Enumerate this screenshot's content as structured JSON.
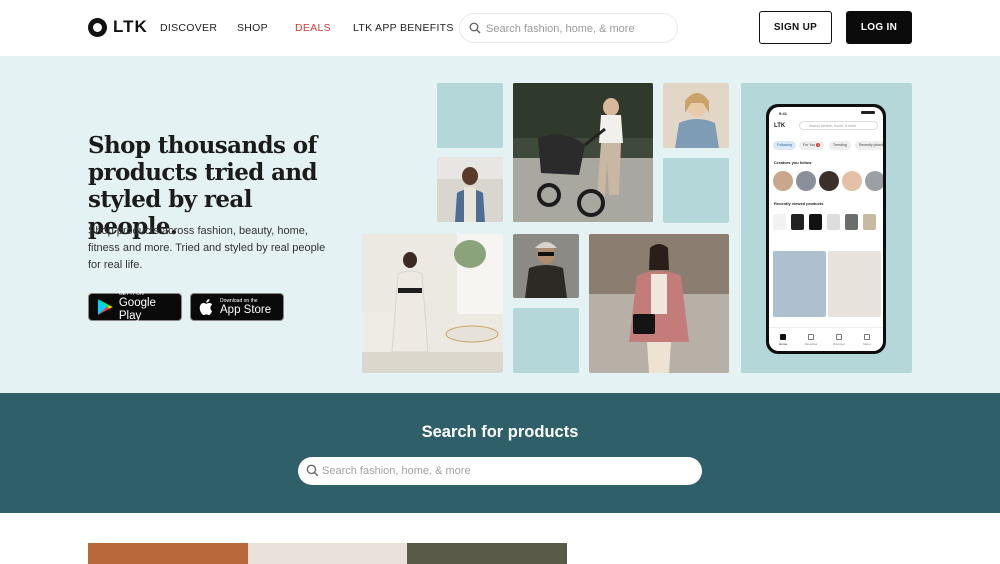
{
  "header": {
    "logo_text": "LTK",
    "nav": [
      {
        "label": "DISCOVER"
      },
      {
        "label": "SHOP"
      },
      {
        "label": "DEALS"
      },
      {
        "label": "LTK APP BENEFITS"
      }
    ],
    "search_placeholder": "Search fashion, home, & more",
    "signup_label": "SIGN UP",
    "login_label": "LOG IN"
  },
  "hero": {
    "title": "Shop thousands of products tried and styled by real people.",
    "subtitle": "Shop products across fashion, beauty, home, fitness and more. Tried and styled by real people for real life.",
    "google_play": {
      "small": "GET IT ON",
      "big": "Google Play"
    },
    "app_store": {
      "small": "Download on the",
      "big": "App Store"
    }
  },
  "phone": {
    "time": "9:41",
    "logo": "LTK",
    "search_placeholder": "Search fashion, home, & more",
    "chips": [
      "Following",
      "For You",
      "Trending",
      "Recently joined"
    ],
    "for_you_badge": "1",
    "creators_label": "Creators you follow",
    "recent_label": "Recently viewed products",
    "tabs": [
      "Home",
      "Favorites",
      "Discover",
      "Menu"
    ]
  },
  "search_band": {
    "title": "Search for products",
    "placeholder": "Search fashion, home, & more"
  },
  "colors": {
    "hero_bg": "#e4f2f3",
    "tile": "#b4d7da",
    "band_bg": "#2f5f69",
    "deals": "#d0393a"
  }
}
